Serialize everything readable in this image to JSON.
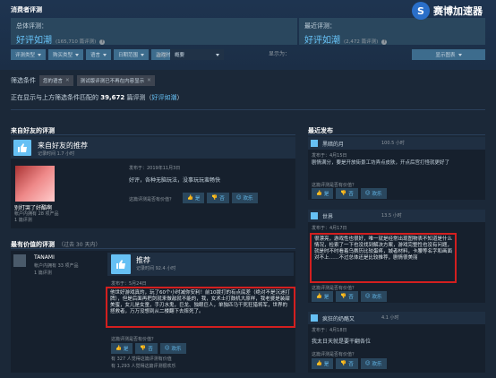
{
  "header": {
    "section_title": "消费者评测",
    "overall_label": "总体评测：",
    "overall_value": "好评如潮",
    "overall_count": "(165,710 篇评测)",
    "recent_label": "最近评测：",
    "recent_value": "好评如潮",
    "recent_count": "(2,472 篇评测)",
    "filters": [
      "评测类型",
      "购买类型",
      "语言",
      "日期范围",
      "游戏时间"
    ],
    "display_label": "显示",
    "display_value": "概要",
    "display_as": "显示为：",
    "display_as_btn": "显示图表"
  },
  "logo": {
    "text": "赛博加速器"
  },
  "filters_bar": {
    "label": "筛选条件",
    "tags": [
      "您的语言",
      "测试版评测已不再在内容显示"
    ],
    "result_prefix": "正在显示与上方筛选条件匹配的",
    "result_count": "39,672",
    "result_suffix": "篇评测（",
    "result_rating": "好评如潮",
    "result_close": "）"
  },
  "friends": {
    "section_title": "来自好友的评测",
    "review_title": "来自好友的推荐",
    "hours": "记录时间 1.7 小时",
    "posted": "发布于：2019年11月3日",
    "body": "好评，各种无脑玩法，没事玩玩蛮畅快",
    "helpful_q": "这篇评测是否有价值？",
    "btn_yes": "是",
    "btn_no": "否",
    "btn_funny": "欢乐",
    "user_name": "别打哭了好酷啊",
    "user_products": "帐户内拥有 28 项产品",
    "user_reviews": "1 篇评测"
  },
  "helpful": {
    "section_title": "最有价值的评测",
    "period": "（过去 30 天内）",
    "user_name": "TANAMI",
    "user_products": "帐户内拥有 33 项产品",
    "user_reviews": "1 篇评测",
    "review_title": "推荐",
    "hours": "记录时间 92.4 小时",
    "posted": "发布于：5月24日",
    "body": "他世好游戏真的，玩了60个小时减你安利！前10拨打的有点底差（绝对不是沉迷打牌），但是后面再把剑就来做敌就不能的，我，女术士打鼓机大原样，我老婆是装甜美蜜，女儿是女童，手刃水鬼，巨龙、独眼巨人，单独匹马干死狂猎将军，世界的拯救者，万万没想到从二楼翻下去摔死了。",
    "helpful_q": "这篇评测是否有价值？",
    "btn_yes": "是",
    "btn_no": "否",
    "btn_funny": "欢乐",
    "stat1": "有 327 人觉得这篇评测有价值",
    "stat2": "有 1,293 人觉得这篇评测很欢乐"
  },
  "recent": {
    "section_title": "最近发布",
    "items": [
      {
        "user": "黑暗的月",
        "hours": "100.5 小时",
        "posted": "发布于：4月15日",
        "body": "剧情满分，要是开放街景工坊弄点皮肤，开点后宫打怪就更好了",
        "helpful_q": "这篇评测是否有价值？",
        "btn_yes": "是",
        "btn_no": "否",
        "btn_funny": "欢乐"
      },
      {
        "user": "世界",
        "hours": "13.5 小时",
        "posted": "发布于：4月17日",
        "body": "很漂亮，游戏性也很好，唯一就是经常出现图物表不知道是什么情况，检索了一下也没找到解决方案，游戏完整性也没有问题，就是时不时看着乌赛历比较蛋疼，城者材料，卡腰等名字和画面对不上……不过总体还是比较推荐，剧情很美丽",
        "helpful_q": "这篇评测是否有价值？",
        "btn_yes": "是",
        "btn_no": "否",
        "btn_funny": "欢乐"
      },
      {
        "user": "疯狂的奶酪又",
        "hours": "4.1 小时",
        "posted": "发布于：4月18日",
        "body": "我太日天就是要干翻各位",
        "helpful_q": "这篇评测是否有价值？",
        "btn_yes": "是",
        "btn_no": "否",
        "btn_funny": "欢乐"
      }
    ]
  }
}
